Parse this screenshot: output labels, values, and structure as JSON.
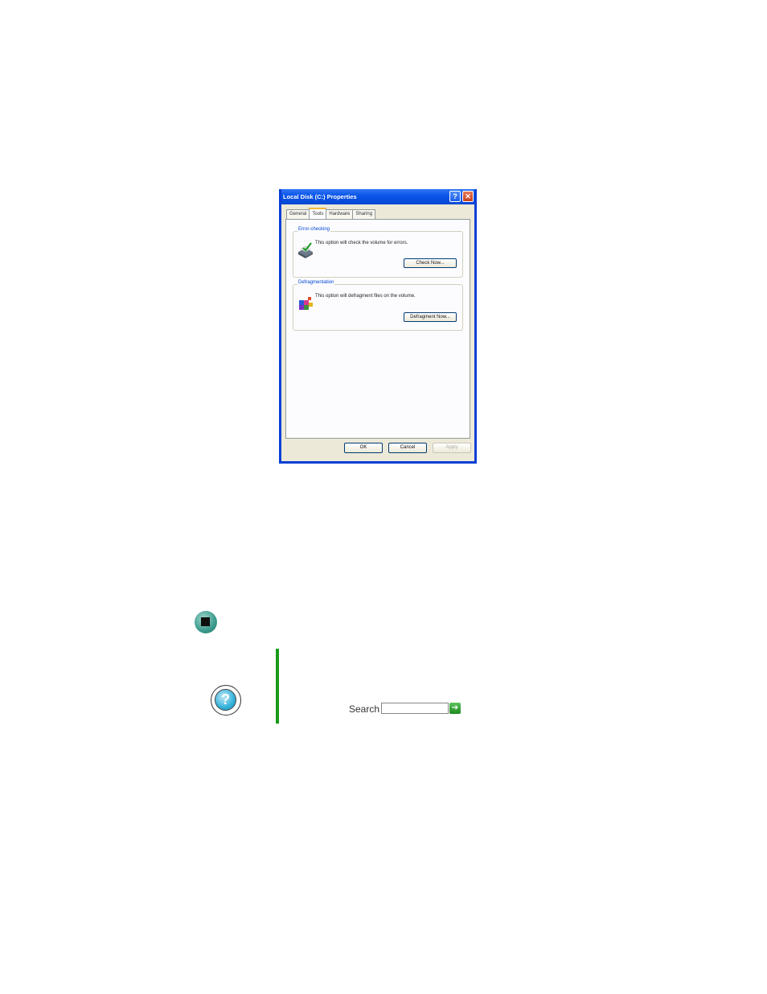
{
  "dialog": {
    "title": "Local Disk (C:) Properties",
    "help_glyph": "?",
    "close_glyph": "✕",
    "tabs": [
      {
        "label": "General"
      },
      {
        "label": "Tools"
      },
      {
        "label": "Hardware"
      },
      {
        "label": "Sharing"
      }
    ],
    "error_checking": {
      "label": "Error-checking",
      "text": "This option will check the volume for errors.",
      "button": "Check Now..."
    },
    "defragmentation": {
      "label": "Defragmentation",
      "text": "This option will defragment files on the volume.",
      "button": "Defragment Now..."
    },
    "buttons": {
      "ok": "OK",
      "cancel": "Cancel",
      "apply": "Apply"
    }
  },
  "help_box": {
    "icon_glyph": "?",
    "search_label": "Search",
    "search_value": "",
    "go_glyph": "➔"
  },
  "icons": {
    "bullet": "stop-bullet-icon",
    "help": "help-question-icon",
    "go": "go-arrow-icon"
  },
  "colors": {
    "titlebar": "#0954e8",
    "accent_bar": "#1b9a1b",
    "group_label": "#0046d5"
  }
}
